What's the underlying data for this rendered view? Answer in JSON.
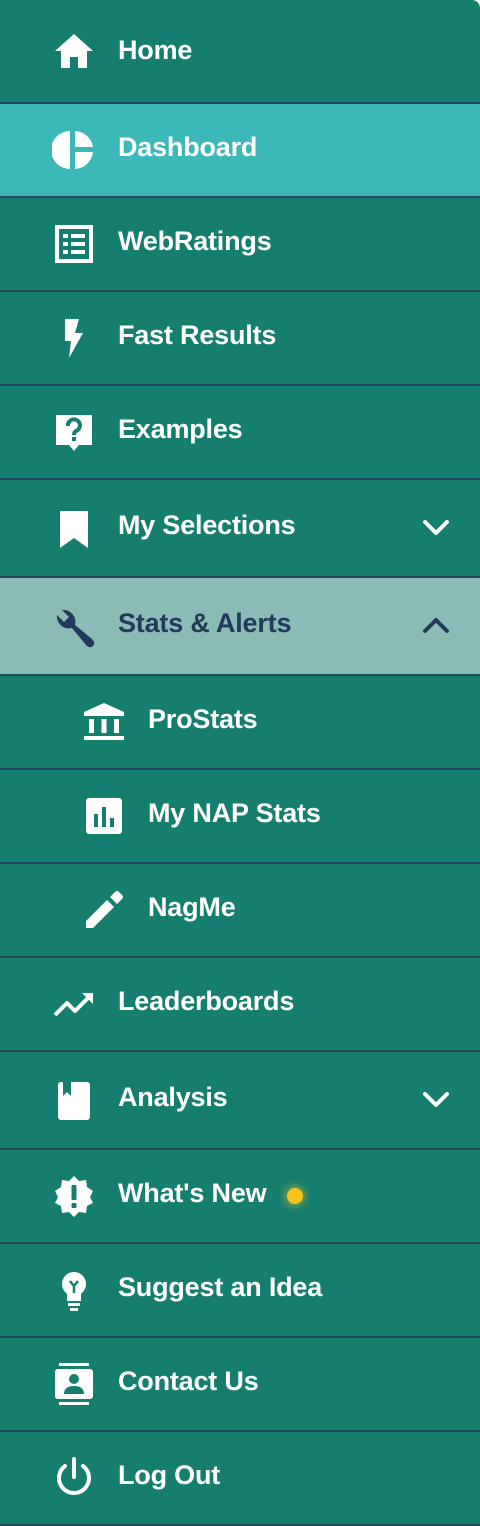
{
  "nav": {
    "home": "Home",
    "dashboard": "Dashboard",
    "webratings": "WebRatings",
    "fast_results": "Fast Results",
    "examples": "Examples",
    "my_selections": "My Selections",
    "stats_alerts": "Stats & Alerts",
    "prostats": "ProStats",
    "my_nap_stats": "My NAP Stats",
    "nagme": "NagMe",
    "leaderboards": "Leaderboards",
    "analysis": "Analysis",
    "whats_new": "What's New",
    "suggest_idea": "Suggest an Idea",
    "contact_us": "Contact Us",
    "log_out": "Log Out"
  },
  "state": {
    "active_item": "Dashboard",
    "expanded_section": "Stats & Alerts",
    "collapsed_sections": [
      "My Selections",
      "Analysis"
    ],
    "whats_new_indicator": "new-updates-dot"
  },
  "colors": {
    "menu_bg": "#167e6f",
    "active_bg": "#3bb8b7",
    "expanded_bg": "#8abbb5",
    "divider": "#25475a",
    "expanded_text": "#25395a",
    "indicator": "#f7c21a"
  },
  "icons": {
    "home": "home-icon",
    "dashboard": "pie-chart-icon",
    "webratings": "list-alt-icon",
    "fast_results": "lightning-bolt-icon",
    "examples": "question-bubble-icon",
    "my_selections": "bookmark-icon",
    "stats_alerts": "wrench-icon",
    "prostats": "bank-icon",
    "my_nap_stats": "bar-chart-box-icon",
    "nagme": "pencil-icon",
    "leaderboards": "trending-up-icon",
    "analysis": "book-icon",
    "whats_new": "alert-badge-icon",
    "suggest_idea": "lightbulb-icon",
    "contact_us": "contact-card-icon",
    "log_out": "power-icon"
  }
}
